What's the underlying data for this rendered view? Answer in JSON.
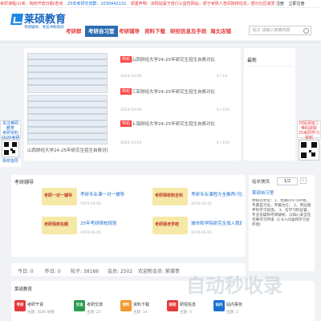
{
  "topbar": {
    "left": "考研课程/公考、院校开放日期/查询",
    "mid": "25年考研交流群：1030442132",
    "notice": "郑重声明：该网站属于自行公益性网站，便于考研人查阅院校信息，部分社区或党员信息来源网",
    "right1": "注册",
    "right2": "立即注册"
  },
  "logo": {
    "title": "莱硕教育",
    "sub": "考研辅导、考前冲刺培训"
  },
  "nav": [
    {
      "label": "考研群",
      "active": false
    },
    {
      "label": "考研自习室",
      "active": true
    },
    {
      "label": "考研辅导",
      "active": false
    },
    {
      "label": "资料下载",
      "active": false
    },
    {
      "label": "研招信息及手段",
      "active": false
    },
    {
      "label": "海文店铺",
      "active": false
    }
  ],
  "search": {
    "placeholder": "帖子  请输入搜索内容"
  },
  "posts": [
    {
      "tag": "热帖",
      "title": "山西财经大学24-25年研究生招生自费对比",
      "date": "2024-10-09",
      "views": "0 / 10"
    },
    {
      "tag": "热帖",
      "title": "三亚财经大学24-25年研究生招生自费对比",
      "date": "2024-10-09",
      "views": "0 / 101"
    },
    {
      "tag": "热帖",
      "title": "上海财经大学24-25年研究生招生自费对比",
      "date": "2024-10-03",
      "views": "0 / 101"
    }
  ],
  "post_caption": "山西财经大学24-25年研究生招生自费对比",
  "sidebar_title": "最新",
  "left_float": {
    "line1": "关注莱硕教育",
    "line2": "考研资料",
    "line3": "2025考研",
    "line4": "择校指导"
  },
  "right_float": {
    "line1": "扫码添加二维码获取",
    "line2": "25考研学习资料"
  },
  "section2_title": "考研辅导",
  "courses": [
    {
      "img_text": "考研一对一辅导",
      "title": "考研专业课一对一辅导",
      "date": "1970-01-01",
      "color": "#1a6fd1"
    },
    {
      "img_text": "考研择校和全科",
      "title": "考研专业课程大全推荐(可直接报班)",
      "date": "1970-01-01",
      "color": "#1a6fd1"
    },
    {
      "img_text": "考研择校名额",
      "title": "25年考研择校规划",
      "date": "1970-01-01",
      "color": "#1a6fd1"
    },
    {
      "img_text": "考研报考学校",
      "title": "城市和学院研究生加入我们辅导团队",
      "date": "1970-01-01",
      "color": "#1a6fd1"
    }
  ],
  "notice_panel": {
    "header": "站长快讯",
    "pager": "1/2",
    "title": "莱硕自习室",
    "body": "你好的文化：1、优质的学习环境，专属自习位，专属台灯。 2、周边陪伴的学习氛围。 3、在学习阶段督，专业答疑和考研辅导。以知心安全在宅事学习环境（1-6人间桌和学习台环境）"
  },
  "stats": [
    {
      "icon": "今日",
      "value": "今日: 0"
    },
    {
      "icon": "昨日",
      "value": "昨日: 0"
    },
    {
      "icon": "帖子",
      "value": "帖子: 38186"
    },
    {
      "icon": "会员",
      "value": "会员: 2502"
    },
    {
      "icon": "欢迎",
      "value": "欢迎新会员: 紫凝哥"
    }
  ],
  "resources": {
    "title": "莱硕教育",
    "items": [
      {
        "icon": "考研",
        "label": "考研干货",
        "count": "主题: 3546 帖数",
        "color": "#e4393c"
      },
      {
        "icon": "交流",
        "label": "考研交流",
        "count": "主题: 23",
        "color": "#2b9a4f"
      },
      {
        "icon": "资料",
        "label": "资料下载",
        "count": "主题: 14",
        "color": "#f2992e"
      },
      {
        "icon": "研招",
        "label": "研招信息",
        "count": "主题: 0",
        "color": "#e4393c"
      },
      {
        "icon": "站内",
        "label": "站内事务",
        "count": "主题: 2",
        "color": "#1a6fd1"
      }
    ]
  },
  "watermark": "自动秒收录",
  "colors": {
    "brand": "#1565c0",
    "accent": "#e4393c",
    "nav_active": "#2b6cb0"
  }
}
